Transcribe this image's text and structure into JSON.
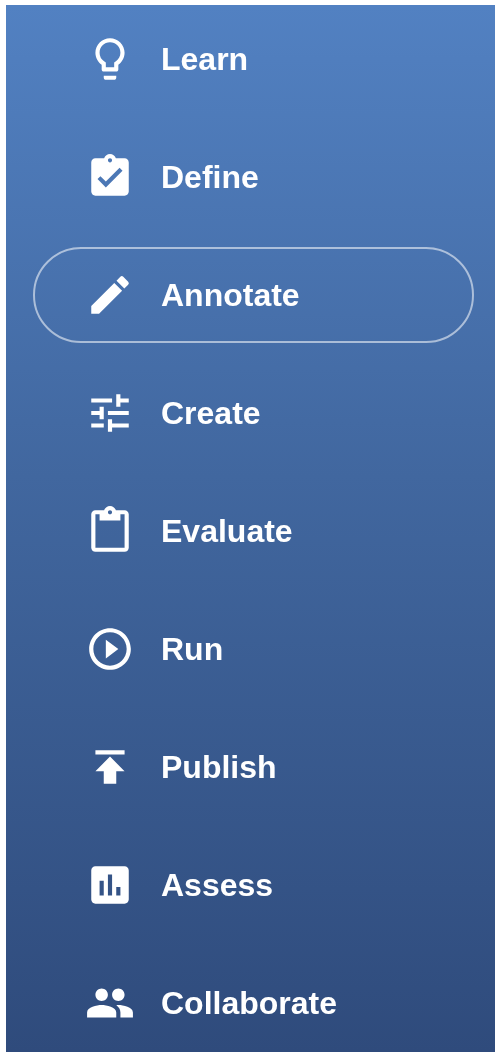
{
  "nav": [
    {
      "label": "Learn",
      "selected": false
    },
    {
      "label": "Define",
      "selected": false
    },
    {
      "label": "Annotate",
      "selected": true
    },
    {
      "label": "Create",
      "selected": false
    },
    {
      "label": "Evaluate",
      "selected": false
    },
    {
      "label": "Run",
      "selected": false
    },
    {
      "label": "Publish",
      "selected": false
    },
    {
      "label": "Assess",
      "selected": false
    },
    {
      "label": "Collaborate",
      "selected": false
    }
  ]
}
